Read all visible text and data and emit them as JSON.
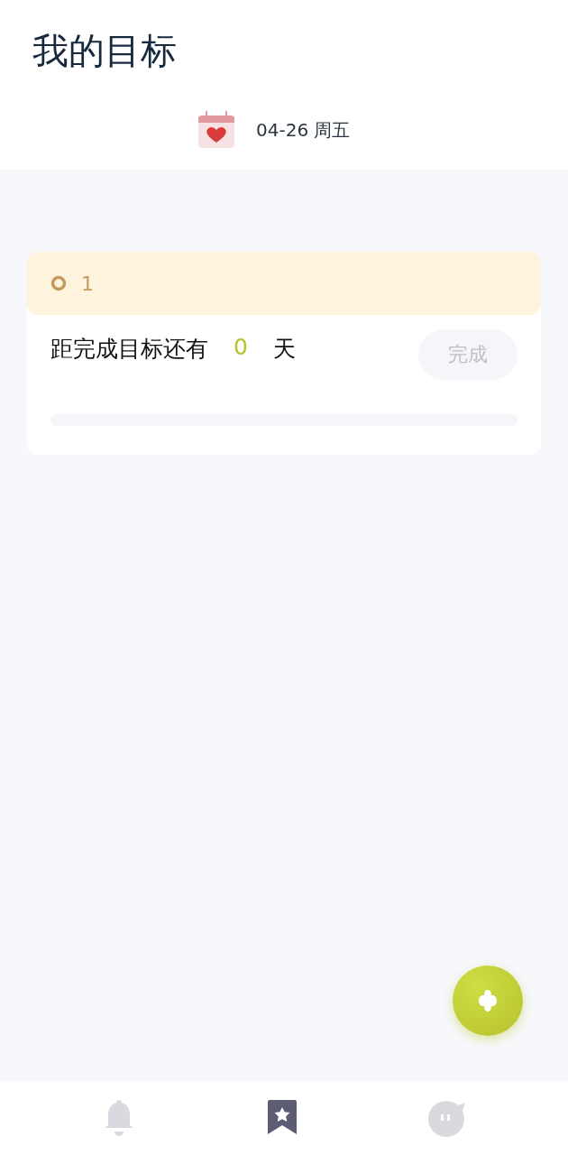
{
  "header": {
    "title": "我的目标",
    "date": "04-26 周五"
  },
  "goals": [
    {
      "name": "1",
      "prefix": "距完成目标还有",
      "days": "0",
      "suffix": "天",
      "button": "完成",
      "level": 0
    }
  ],
  "tabs": [
    {
      "kind": "bell",
      "selected": false
    },
    {
      "kind": "bookmark",
      "selected": true
    },
    {
      "kind": "chat",
      "selected": false
    }
  ]
}
